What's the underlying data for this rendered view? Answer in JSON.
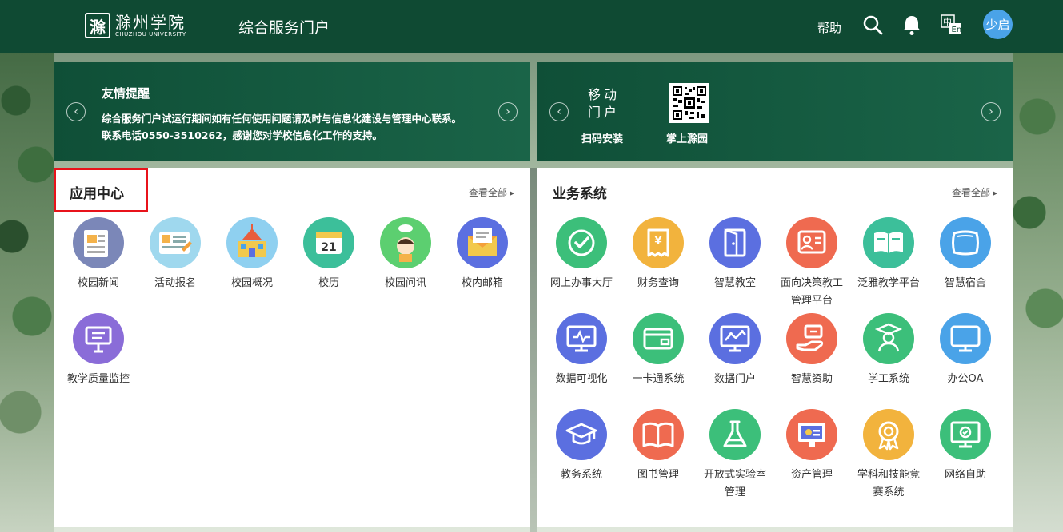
{
  "header": {
    "logo_mark": "滁",
    "logo_cn": "滁州学院",
    "logo_en": "CHUZHOU UNIVERSITY",
    "portal_title": "综合服务门户",
    "help_label": "帮助",
    "avatar_text": "少启",
    "bg_color": "#0f4a33"
  },
  "notice": {
    "title": "友情提醒",
    "line1": "综合服务门户试运行期间如有任何使用问题请及时与信息化建设与管理中心联系。",
    "line2": "联系电话0550-3510262，感谢您对学校信息化工作的支持。"
  },
  "mobile": {
    "title_line1": "移动",
    "title_line2": "门户",
    "scan_label": "扫码安装",
    "qr_label": "掌上滁园"
  },
  "app_center": {
    "title": "应用中心",
    "view_all": "查看全部",
    "items": [
      {
        "name": "校园新闻",
        "icon": "newspaper-icon",
        "color": "#7b87b8"
      },
      {
        "name": "活动报名",
        "icon": "signup-form-icon",
        "color": "#9fd8ee"
      },
      {
        "name": "校园概况",
        "icon": "school-building-icon",
        "color": "#8fd0f0"
      },
      {
        "name": "校历",
        "icon": "calendar-icon",
        "color": "#3cbf9a"
      },
      {
        "name": "校园问讯",
        "icon": "student-avatar-icon",
        "color": "#5ccf70"
      },
      {
        "name": "校内邮箱",
        "icon": "envelope-icon",
        "color": "#5b6fe0"
      },
      {
        "name": "教学质量监控",
        "icon": "presentation-board-icon",
        "color": "#8a6cd8"
      }
    ]
  },
  "business": {
    "title": "业务系统",
    "view_all": "查看全部",
    "items": [
      {
        "name": "网上办事大厅",
        "icon": "checkmark-icon",
        "color": "#3cbf7a"
      },
      {
        "name": "财务查询",
        "icon": "receipt-yuan-icon",
        "color": "#f2b33d"
      },
      {
        "name": "智慧教室",
        "icon": "door-icon",
        "color": "#5b6fe0"
      },
      {
        "name": "面向决策教工管理平台",
        "icon": "id-card-icon",
        "color": "#ef6a50"
      },
      {
        "name": "泛雅教学平台",
        "icon": "open-book-icon",
        "color": "#3cbf9a"
      },
      {
        "name": "智慧宿舍",
        "icon": "pillow-icon",
        "color": "#4aa3e8"
      },
      {
        "name": "数据可视化",
        "icon": "monitor-chart-icon",
        "color": "#5b6fe0"
      },
      {
        "name": "一卡通系统",
        "icon": "card-icon",
        "color": "#3cbf7a"
      },
      {
        "name": "数据门户",
        "icon": "monitor-line-icon",
        "color": "#5b6fe0"
      },
      {
        "name": "智慧资助",
        "icon": "hand-money-icon",
        "color": "#ef6a50"
      },
      {
        "name": "学工系统",
        "icon": "graduate-icon",
        "color": "#3cbf7a"
      },
      {
        "name": "办公OA",
        "icon": "desktop-icon",
        "color": "#4aa3e8"
      },
      {
        "name": "教务系统",
        "icon": "mortarboard-icon",
        "color": "#5b6fe0"
      },
      {
        "name": "图书管理",
        "icon": "book-icon",
        "color": "#ef6a50"
      },
      {
        "name": "开放式实验室管理",
        "icon": "flask-icon",
        "color": "#3cbf7a"
      },
      {
        "name": "资产管理",
        "icon": "asset-monitor-icon",
        "color": "#ef6a50"
      },
      {
        "name": "学科和技能竞赛系统",
        "icon": "medal-icon",
        "color": "#f2b33d"
      },
      {
        "name": "网络自助",
        "icon": "network-monitor-icon",
        "color": "#3cbf7a"
      }
    ]
  }
}
